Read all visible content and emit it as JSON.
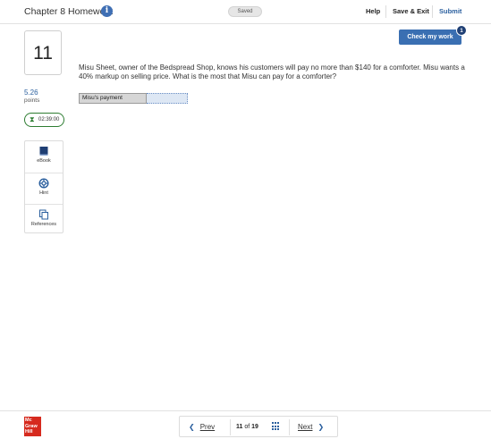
{
  "header": {
    "title": "Chapter 8 Homework",
    "info_icon": "i",
    "saved_status": "Saved",
    "help_label": "Help",
    "save_exit_label": "Save & Exit",
    "submit_label": "Submit"
  },
  "question": {
    "number": "11",
    "points_value": "5.26",
    "points_label": "points",
    "timer": "02:39:00",
    "text": "Misu Sheet, owner of the Bedspread Shop, knows his customers will pay no more than $140 for a comforter. Misu wants a 40% markup on selling price. What is the most that Misu can pay for a comforter?",
    "answer_label": "Misu's payment",
    "answer_value": ""
  },
  "tools": [
    {
      "label": "eBook",
      "icon": "book-icon"
    },
    {
      "label": "Hint",
      "icon": "lifebuoy-icon"
    },
    {
      "label": "References",
      "icon": "copy-icon"
    }
  ],
  "check_work": {
    "label": "Check my work",
    "badge": "1"
  },
  "footer": {
    "logo_lines": [
      "Mc",
      "Graw",
      "Hill"
    ],
    "prev_label": "Prev",
    "next_label": "Next",
    "page_current": "11",
    "page_of": "of",
    "page_total": "19"
  },
  "colors": {
    "accent": "#3a6fb2",
    "timer_green": "#2e7d32",
    "logo_red": "#d62a1e"
  }
}
